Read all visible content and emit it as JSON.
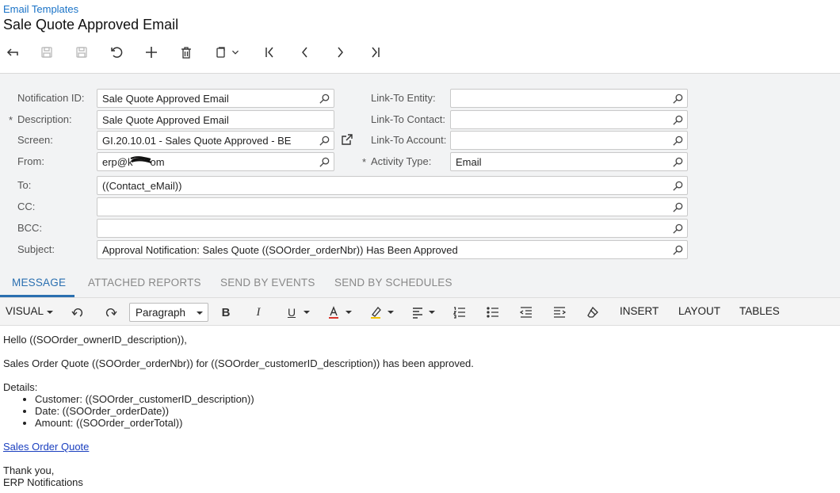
{
  "breadcrumb": "Email Templates",
  "title": "Sale Quote Approved Email",
  "toolbar_icons": [
    "undo-arrow-icon",
    "save-icon",
    "save-close-icon",
    "cancel-icon",
    "add-icon",
    "delete-icon",
    "copy-paste-icon",
    "first-icon",
    "prev-icon",
    "next-icon",
    "last-icon"
  ],
  "form": {
    "notification_id": {
      "label": "Notification ID:",
      "value": "Sale Quote Approved Email"
    },
    "description": {
      "required": "*",
      "label": "Description:",
      "value": "Sale Quote Approved Email"
    },
    "screen": {
      "label": "Screen:",
      "value": "GI.20.10.01 - Sales Quote Approved - BE"
    },
    "from": {
      "label": "From:",
      "value_prefix": "erp@k",
      "value_suffix": "om"
    },
    "to": {
      "label": "To:",
      "value": "((Contact_eMail))"
    },
    "cc": {
      "label": "CC:",
      "value": ""
    },
    "bcc": {
      "label": "BCC:",
      "value": ""
    },
    "subject": {
      "label": "Subject:",
      "value": "Approval Notification: Sales Quote ((SOOrder_orderNbr)) Has Been Approved"
    },
    "link_entity": {
      "label": "Link-To Entity:",
      "value": ""
    },
    "link_contact": {
      "label": "Link-To Contact:",
      "value": ""
    },
    "link_account": {
      "label": "Link-To Account:",
      "value": ""
    },
    "activity_type": {
      "required": "*",
      "label": "Activity Type:",
      "value": "Email"
    }
  },
  "tabs": [
    "MESSAGE",
    "ATTACHED REPORTS",
    "SEND BY EVENTS",
    "SEND BY SCHEDULES"
  ],
  "editor": {
    "mode": "VISUAL",
    "paragraph": "Paragraph",
    "insert": "INSERT",
    "layout": "LAYOUT",
    "tables": "TABLES"
  },
  "message": {
    "greeting": "Hello ((SOOrder_ownerID_description)),",
    "line1": "Sales Order Quote ((SOOrder_orderNbr)) for ((SOOrder_customerID_description)) has been approved.",
    "details": "Details:",
    "items": [
      "Customer: ((SOOrder_customerID_description))",
      "Date: ((SOOrder_orderDate))",
      "Amount: ((SOOrder_orderTotal))"
    ],
    "link": "Sales Order Quote",
    "thanks": "Thank you,",
    "signature": "ERP Notifications"
  },
  "colors": {
    "accent": "#2a6fb0",
    "link": "#1a73c7",
    "form_bg": "#f2f3f4"
  }
}
